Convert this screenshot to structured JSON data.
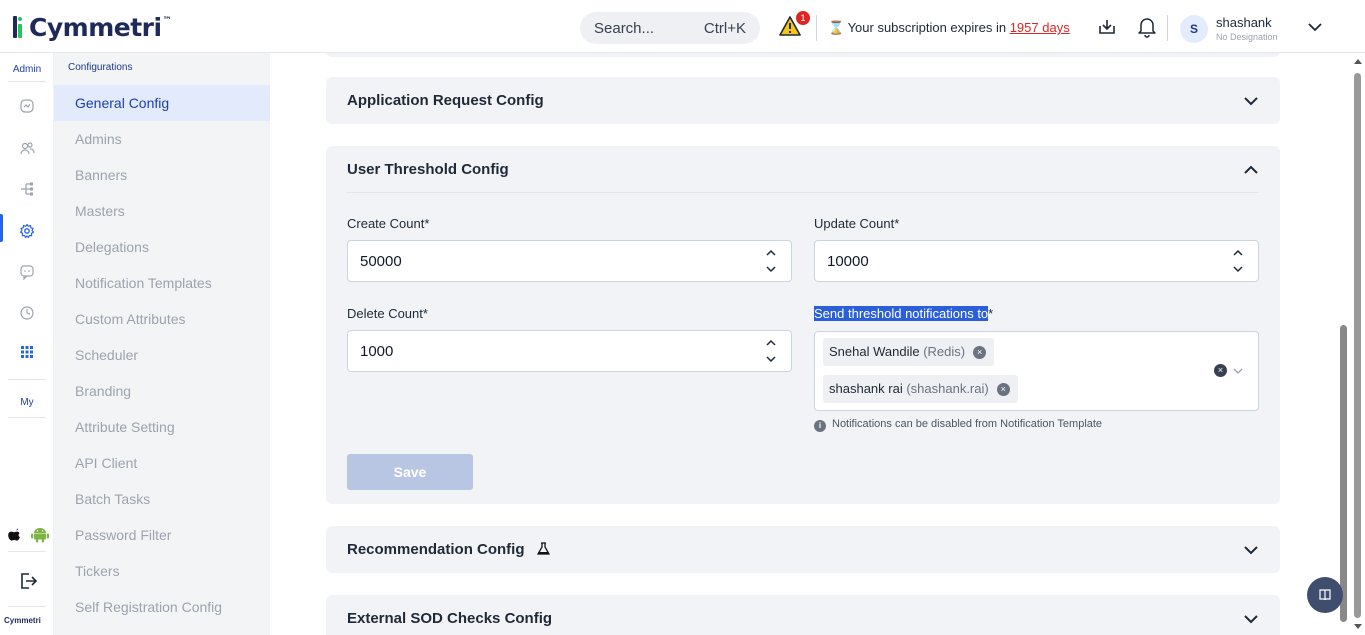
{
  "brand": {
    "name": "Cymmetri",
    "tm": "™",
    "footer_logo": "Cymmetri"
  },
  "header": {
    "search_placeholder": "Search...",
    "search_shortcut": "Ctrl+K",
    "alert_count": "1",
    "subscription_prefix": "Your subscription expires in",
    "subscription_days": "1957 days",
    "user_initial": "S",
    "user_name": "shashank",
    "user_designation": "No Designation"
  },
  "rail": {
    "admin_label": "Admin",
    "my_label": "My",
    "icons": [
      "dashboard-icon",
      "users-icon",
      "hierarchy-icon",
      "settings-icon",
      "chat-icon",
      "history-icon",
      "apps-grid-icon"
    ]
  },
  "subnav": {
    "heading": "Configurations",
    "items": [
      {
        "label": "General Config",
        "active": true
      },
      {
        "label": "Admins"
      },
      {
        "label": "Banners"
      },
      {
        "label": "Masters"
      },
      {
        "label": "Delegations"
      },
      {
        "label": "Notification Templates"
      },
      {
        "label": "Custom Attributes"
      },
      {
        "label": "Scheduler"
      },
      {
        "label": "Branding"
      },
      {
        "label": "Attribute Setting"
      },
      {
        "label": "API Client"
      },
      {
        "label": "Batch Tasks"
      },
      {
        "label": "Password Filter"
      },
      {
        "label": "Tickers"
      },
      {
        "label": "Self Registration Config"
      }
    ]
  },
  "panels": {
    "app_request": {
      "title": "Application Request Config"
    },
    "user_threshold": {
      "title": "User Threshold Config",
      "create_label": "Create Count*",
      "create_value": "50000",
      "update_label": "Update Count*",
      "update_value": "10000",
      "delete_label": "Delete Count*",
      "delete_value": "1000",
      "notify_label": "Send threshold notifications to",
      "notify_required": "*",
      "recipients": [
        {
          "name": "Snehal Wandile",
          "id": "(Redis)"
        },
        {
          "name": "shashank rai",
          "id": "(shashank.rai)"
        }
      ],
      "hint": "Notifications can be disabled from Notification Template",
      "save_label": "Save"
    },
    "recommendation": {
      "title": "Recommendation Config"
    },
    "external_sod": {
      "title": "External SOD Checks Config"
    }
  },
  "colors": {
    "accent": "#2563eb",
    "brand_navy": "#1e2a5a",
    "danger": "#dc2626",
    "panel_bg": "#f1f3f7"
  }
}
